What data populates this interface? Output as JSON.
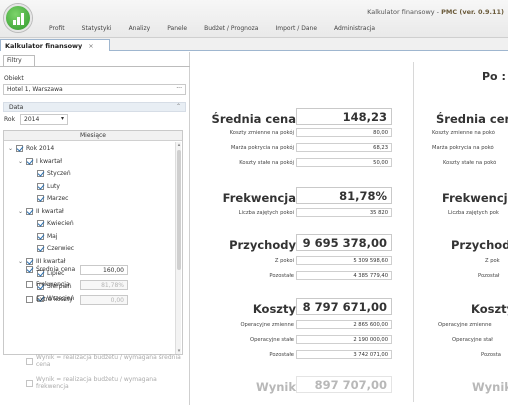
{
  "window": {
    "title_prefix": "Kalkulator finansowy - ",
    "title_app": "PMC (ver. 0.9.11)"
  },
  "menu": [
    "Profit",
    "Statystyki",
    "Analizy",
    "Panele",
    "Budżet / Prognoza",
    "Import / Dane",
    "Administracja"
  ],
  "doc_tab": {
    "label": "Kalkulator finansowy",
    "close": "×"
  },
  "filters": {
    "tab_label": "Filtry",
    "object_label": "Obiekt",
    "object_value": "Hotel 1, Warszawa",
    "object_more": "···",
    "date_group": "Data",
    "year_label": "Rok",
    "year_value": "2014",
    "tree_header": "Miesiące",
    "tree": [
      {
        "label": "Rok 2014",
        "level": 0,
        "expander": "⌄"
      },
      {
        "label": "I kwartał",
        "level": 1,
        "expander": "⌄"
      },
      {
        "label": "Styczeń",
        "level": 2,
        "expander": ""
      },
      {
        "label": "Luty",
        "level": 2,
        "expander": ""
      },
      {
        "label": "Marzec",
        "level": 2,
        "expander": ""
      },
      {
        "label": "II kwartał",
        "level": 1,
        "expander": "⌄"
      },
      {
        "label": "Kwiecień",
        "level": 2,
        "expander": ""
      },
      {
        "label": "Maj",
        "level": 2,
        "expander": ""
      },
      {
        "label": "Czerwiec",
        "level": 2,
        "expander": ""
      },
      {
        "label": "III kwartał",
        "level": 1,
        "expander": "⌄"
      },
      {
        "label": "Lipiec",
        "level": 2,
        "expander": ""
      },
      {
        "label": "Sierpień",
        "level": 2,
        "expander": ""
      },
      {
        "label": "Wrzesień",
        "level": 2,
        "expander": ""
      }
    ],
    "options": [
      {
        "label": "Średnia cena",
        "value": "160,00",
        "checked": true,
        "disabled": false
      },
      {
        "label": "Frekwencja",
        "value": "81,78%",
        "checked": false,
        "disabled": false
      },
      {
        "label": "Extra koszty",
        "value": "0,00",
        "checked": false,
        "disabled": false
      }
    ],
    "result_options": [
      "Wynik = realizacja budżetu / wymagana średnia cena",
      "Wynik = realizacja budżetu / wymagana frekwencja"
    ]
  },
  "summary": {
    "avg_price": {
      "label": "Średnia cena",
      "value": "148,23"
    },
    "avg_price_rows": [
      {
        "label": "Koszty zmienne na pokój",
        "value": "80,00"
      },
      {
        "label": "Marża pokrycia na pokój",
        "value": "68,23"
      },
      {
        "label": "Koszty stałe na pokój",
        "value": "50,00"
      }
    ],
    "occupancy": {
      "label": "Frekwencja",
      "value": "81,78%"
    },
    "occupancy_rows": [
      {
        "label": "Liczba zajętych pokoi",
        "value": "35 820"
      }
    ],
    "revenue": {
      "label": "Przychody",
      "value": "9 695 378,00"
    },
    "revenue_rows": [
      {
        "label": "Z pokoi",
        "value": "5 309 598,60"
      },
      {
        "label": "Pozostałe",
        "value": "4 385 779,40"
      }
    ],
    "costs": {
      "label": "Koszty",
      "value": "8 797 671,00"
    },
    "costs_rows": [
      {
        "label": "Operacyjne zmienne",
        "value": "2 865 600,00"
      },
      {
        "label": "Operacyjne stałe",
        "value": "2 190 000,00"
      },
      {
        "label": "Pozostałe",
        "value": "3 742 071,00"
      }
    ],
    "result": {
      "label": "Wynik",
      "value": "897 707,00"
    }
  },
  "right_panel": {
    "header": "Po :",
    "avg_price_label": "Średnia cena",
    "avg_price_rows": [
      "Koszty zmienne na pokó",
      "Marża pokrycia na pokó",
      "Koszty stałe na pokó"
    ],
    "occupancy_label": "Frekwencja",
    "occupancy_row": "Liczba zajętych pok",
    "revenue_label": "Przychody",
    "revenue_rows": [
      "Z pok",
      "Pozostał"
    ],
    "costs_label": "Koszty",
    "costs_rows": [
      "Operacyjne zmienne",
      "Operacyjne stał",
      "Pozosta"
    ],
    "result_label": "Wynik"
  }
}
